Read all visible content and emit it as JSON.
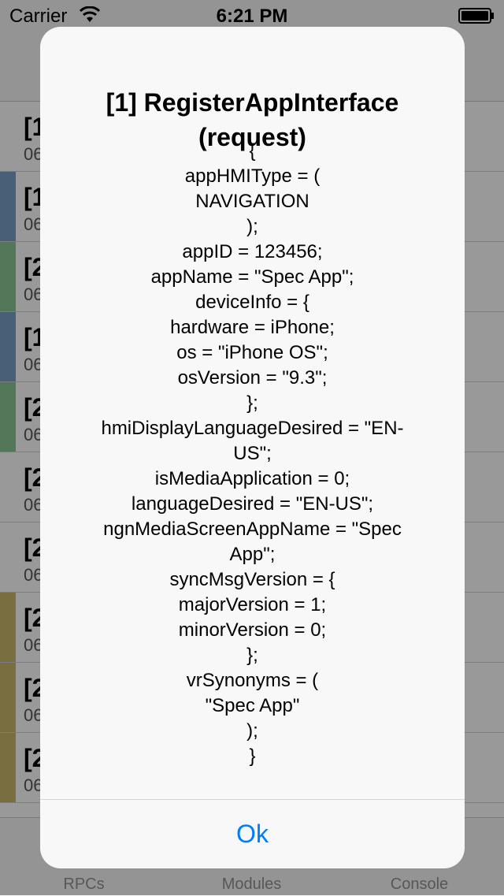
{
  "status_bar": {
    "carrier": "Carrier",
    "time": "6:21 PM"
  },
  "list_rows": [
    {
      "title": "[1",
      "subtitle": "06",
      "color": "#ffffff"
    },
    {
      "title": "[1",
      "subtitle": "06",
      "color": "#7b9fc7"
    },
    {
      "title": "[2",
      "subtitle": "06",
      "color": "#8cc795"
    },
    {
      "title": "[1",
      "subtitle": "06",
      "color": "#7b9fc7"
    },
    {
      "title": "[2",
      "subtitle": "06",
      "color": "#8cc795"
    },
    {
      "title": "[2",
      "subtitle": "06",
      "color": "#ffffff"
    },
    {
      "title": "[2",
      "subtitle": "06",
      "color": "#ffffff"
    },
    {
      "title": "[2",
      "subtitle": "06",
      "color": "#c9b86a"
    },
    {
      "title": "[2",
      "subtitle": "06",
      "color": "#c9b86a"
    },
    {
      "title": "[2",
      "subtitle": "06",
      "color": "#c9b86a"
    }
  ],
  "tab_bar": {
    "tabs": [
      "RPCs",
      "Modules",
      "Console"
    ]
  },
  "alert": {
    "title_line1": "[1] RegisterAppInterface",
    "title_line2": "(request)",
    "message_lines": [
      "{",
      "appHMIType = (",
      "NAVIGATION",
      ");",
      "appID = 123456;",
      "appName = \"Spec App\";",
      "deviceInfo = {",
      "hardware = iPhone;",
      "os = \"iPhone OS\";",
      "osVersion = \"9.3\";",
      "};",
      "hmiDisplayLanguageDesired = \"EN-",
      "US\";",
      "isMediaApplication = 0;",
      "languageDesired = \"EN-US\";",
      "ngnMediaScreenAppName = \"Spec",
      "App\";",
      "syncMsgVersion = {",
      "majorVersion = 1;",
      "minorVersion = 0;",
      "};",
      "vrSynonyms = (",
      "\"Spec App\"",
      ");",
      "}"
    ],
    "ok_label": "Ok"
  }
}
